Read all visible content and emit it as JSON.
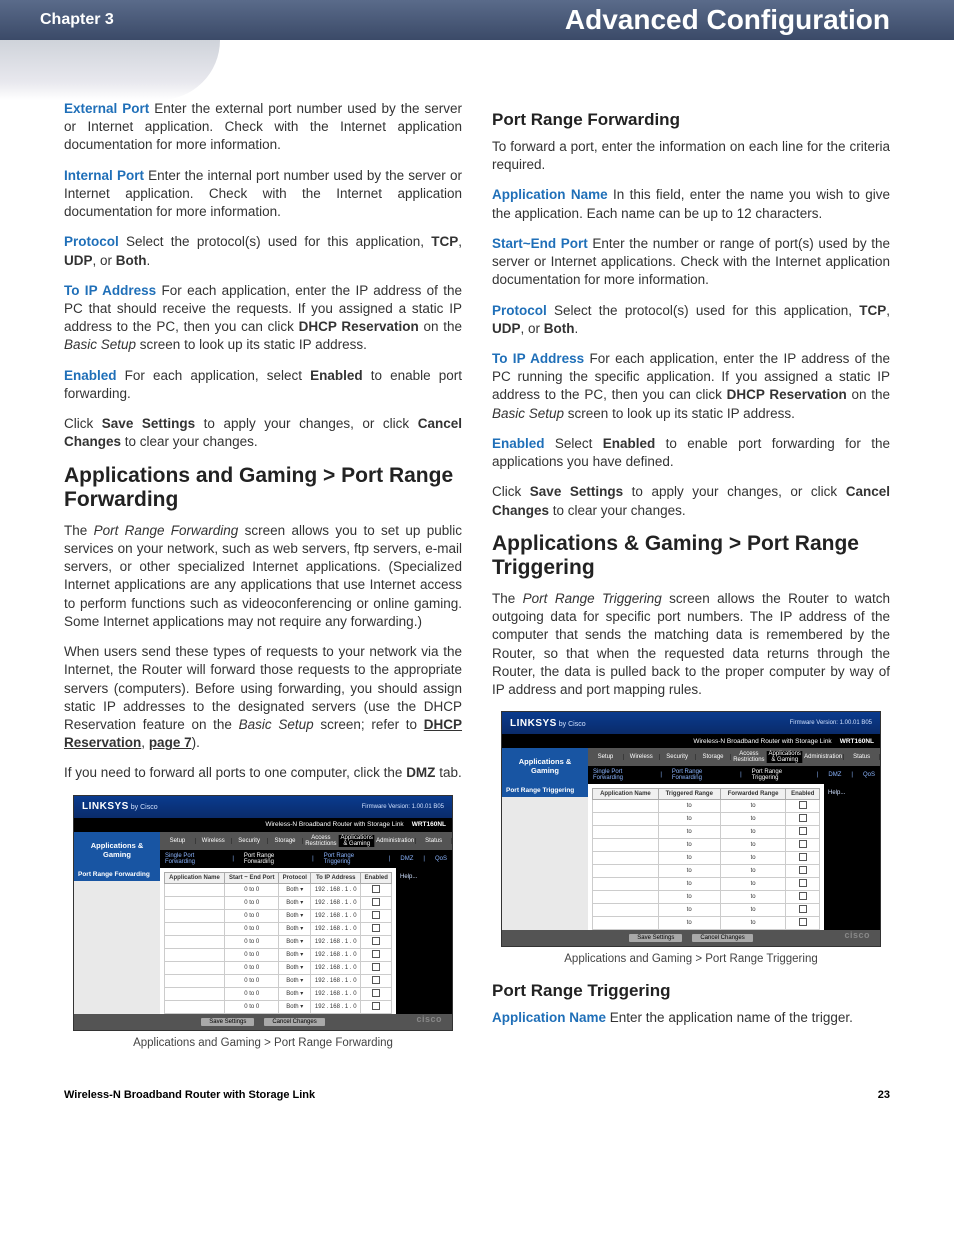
{
  "header": {
    "chapter": "Chapter 3",
    "title": "Advanced Configuration"
  },
  "left": {
    "p1_term": "External Port",
    "p1_body": "  Enter the external port number used by the server or Internet application. Check with the Internet application documentation for more information.",
    "p2_term": "Internal Port",
    "p2_body": "  Enter the internal port number used by the server or Internet application. Check with the Internet application documentation for more information.",
    "p3_term": "Protocol",
    "p3_a": "  Select the protocol(s) used for this application, ",
    "p3_tcp": "TCP",
    "p3_c1": ", ",
    "p3_udp": "UDP",
    "p3_c2": ", or ",
    "p3_both": "Both",
    "p3_end": ".",
    "p4_term": "To IP Address",
    "p4_a": "  For each application, enter the IP address of the PC that should receive the requests. If you assigned a static IP address to the PC, then you can click ",
    "p4_dhcp": "DHCP Reservation",
    "p4_b": " on the ",
    "p4_basic": "Basic Setup",
    "p4_c": " screen to look up its static IP address.",
    "p5_term": "Enabled",
    "p5_a": "  For each application, select ",
    "p5_en": "Enabled",
    "p5_b": " to enable port forwarding.",
    "p6_a": "Click ",
    "p6_save": "Save Settings",
    "p6_b": " to apply your changes, or click ",
    "p6_cancel": "Cancel Changes",
    "p6_c": " to clear your changes.",
    "h2": "Applications and Gaming > Port Range Forwarding",
    "p7_a": "The ",
    "p7_em": "Port Range Forwarding",
    "p7_b": " screen allows you to set up public services on your network, such as web servers, ftp servers, e-mail servers, or other specialized Internet applications. (Specialized Internet applications are any applications that use Internet access to perform functions such as videoconferencing or online gaming. Some Internet applications may not require any forwarding.)",
    "p8_a": "When users send these types of requests to your network via the Internet, the Router will forward those requests to the appropriate servers (computers). Before using forwarding, you should assign static IP addresses to the designated servers (use the DHCP Reservation feature on the ",
    "p8_em": "Basic Setup",
    "p8_b": " screen; refer to ",
    "p8_link1": "DHCP Reservation",
    "p8_c": ", ",
    "p8_link2": "page 7",
    "p8_d": ").",
    "p9_a": "If you need to forward all ports to one computer, click the ",
    "p9_dmz": "DMZ",
    "p9_b": " tab.",
    "caption": "Applications and Gaming > Port Range Forwarding"
  },
  "right": {
    "h3a": "Port Range Forwarding",
    "p1": "To forward a port, enter the information on each line for the criteria required.",
    "p2_term": "Application Name",
    "p2_body": "  In this field, enter the name you wish to give the application. Each name can be up to 12 characters.",
    "p3_term": "Start~End Port",
    "p3_body": "  Enter the number or range of port(s) used by the server or Internet applications. Check with the Internet application documentation for more information.",
    "p4_term": "Protocol",
    "p4_a": "  Select the protocol(s) used for this application, ",
    "p4_tcp": "TCP",
    "p4_c1": ", ",
    "p4_udp": "UDP",
    "p4_c2": ", or ",
    "p4_both": "Both",
    "p4_end": ".",
    "p5_term": "To IP Address",
    "p5_a": "  For each application, enter the IP address of the PC running the specific application. If you assigned a static IP address to the PC, then you can click ",
    "p5_dhcp": "DHCP Reservation",
    "p5_b": " on the ",
    "p5_basic": "Basic Setup",
    "p5_c": " screen to look up its static IP address.",
    "p6_term": "Enabled",
    "p6_a": "  Select ",
    "p6_en": "Enabled",
    "p6_b": " to enable port forwarding for the applications you have defined.",
    "p7_a": "Click ",
    "p7_save": "Save Settings",
    "p7_b": " to apply your changes, or click ",
    "p7_cancel": "Cancel Changes",
    "p7_c": " to clear your changes.",
    "h2": "Applications & Gaming > Port Range Triggering",
    "p8_a": "The ",
    "p8_em": "Port Range Triggering",
    "p8_b": " screen allows the Router to watch outgoing data for specific port numbers. The IP address of the computer that sends the matching data is remembered by the Router, so that when the requested data returns through the Router, the data is pulled back to the proper computer by way of IP address and port mapping rules.",
    "caption": "Applications and Gaming > Port Range Triggering",
    "h3b": "Port Range Triggering",
    "p9_term": "Application Name",
    "p9_body": "  Enter the application name of the trigger."
  },
  "shot": {
    "logo": "LINKSYS",
    "bycisco": " by Cisco",
    "fw": "Firmware Version: 1.00.01 B05",
    "router": "Wireless-N Broadband Router with Storage Link",
    "model": "WRT160NL",
    "section": "Applications & Gaming",
    "tabs": [
      "Setup",
      "Wireless",
      "Security",
      "Storage",
      "Access Restrictions",
      "Applications & Gaming",
      "Administration",
      "Status"
    ],
    "sub_prf": [
      "Single Port Forwarding",
      "Port Range Forwarding",
      "Port Range Triggering",
      "DMZ",
      "QoS"
    ],
    "side_prf": "Port Range Forwarding",
    "side_prt": "Port Range Triggering",
    "th_prf": [
      "Application Name",
      "Start ~ End Port",
      "Protocol",
      "To IP Address",
      "Enabled"
    ],
    "th_prt": [
      "Application Name",
      "Triggered Range",
      "Forwarded Range",
      "Enabled"
    ],
    "row_prf": {
      "startend": "0        to  0",
      "proto": "Both ▾",
      "ip": "192 . 168 . 1 . 0"
    },
    "row_prt": {
      "to": "to"
    },
    "help": "Help...",
    "save": "Save Settings",
    "cancel": "Cancel Changes",
    "cisco": "cisco"
  },
  "footer": {
    "left": "Wireless-N Broadband Router with Storage Link",
    "page": "23"
  }
}
